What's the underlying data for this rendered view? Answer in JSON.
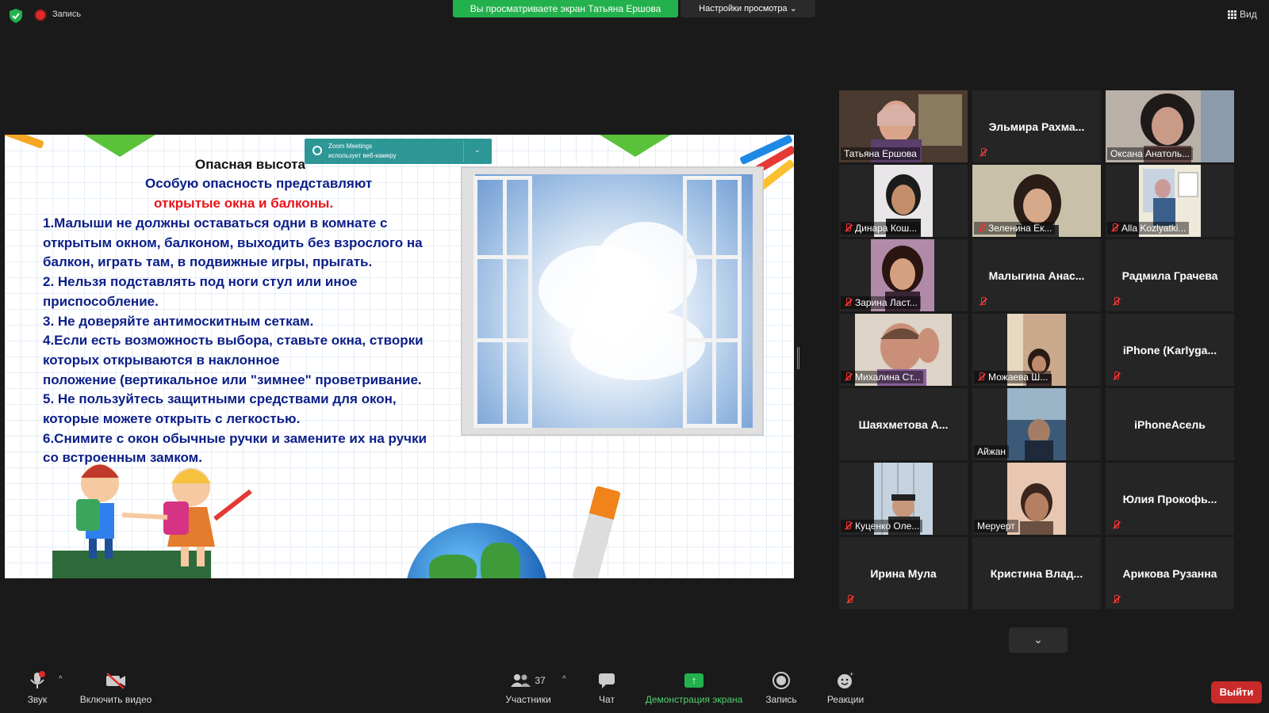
{
  "topbar": {
    "recording_label": "Запись",
    "viewing_banner": "Вы просматриваете экран Татьяна Ершова",
    "view_settings": "Настройки просмотра ⌄",
    "view_label": "Вид"
  },
  "zoom_notice": {
    "line1": "Zoom Meetings",
    "line2": "использует веб-камеру"
  },
  "slide": {
    "title": "Опасная высота",
    "subtitle": "Особую опасность представляют",
    "highlight": "открытые окна и балконы.",
    "lines": [
      "1.Малыши не должны оставаться одни в комнате с",
      "открытым окном, балконом, выходить без взрослого на",
      "балкон, играть там, в подвижные игры, прыгать.",
      "2. Нельзя подставлять под ноги стул или иное",
      "приспособление.",
      "3. Не доверяйте антимоскитным сеткам.",
      "4.Если есть возможность выбора, ставьте окна, створки",
      "которых открываются в наклонное",
      "положение (вертикальное или \"зимнее\" проветривание.",
      "5. Не пользуйтесь защитными средствами для окон,",
      "которые можете открыть с легкостью.",
      "6.Снимите с окон обычные ручки и замените их на ручки",
      "со встроенным замком."
    ]
  },
  "participants": [
    {
      "name": "Татьяна Ершова",
      "video": true,
      "active": true,
      "muted": false
    },
    {
      "name": "Эльмира  Рахма...",
      "video": false,
      "muted": true
    },
    {
      "name": "Оксана Анатоль...",
      "video": true,
      "muted": false
    },
    {
      "name": "Динара Кош...",
      "video": true,
      "muted": true
    },
    {
      "name": "Зеленина Ек...",
      "video": true,
      "muted": true
    },
    {
      "name": "Alla Kozlyatki...",
      "video": true,
      "muted": true
    },
    {
      "name": "Зарина Ласт...",
      "video": true,
      "muted": true
    },
    {
      "name": "Малыгина  Анас...",
      "video": false,
      "muted": true
    },
    {
      "name": "Радмила Грачева",
      "video": false,
      "muted": true
    },
    {
      "name": "Михалина Ст...",
      "video": true,
      "muted": true
    },
    {
      "name": "Можаева Ш...",
      "video": true,
      "muted": true
    },
    {
      "name": "iPhone  (Karlyga...",
      "video": false,
      "muted": true
    },
    {
      "name": "Шаяхметова  А...",
      "video": false,
      "muted": false
    },
    {
      "name": "Айжан",
      "video": true,
      "muted": false
    },
    {
      "name": "iPhoneАсель",
      "video": false,
      "muted": false
    },
    {
      "name": "Куценко Оле...",
      "video": true,
      "muted": true
    },
    {
      "name": "Меруерт",
      "video": true,
      "muted": false
    },
    {
      "name": "Юлия  Прокофь...",
      "video": false,
      "muted": true
    },
    {
      "name": "Ирина Мула",
      "video": false,
      "muted": true
    },
    {
      "name": "Кристина  Влад...",
      "video": false,
      "muted": false
    },
    {
      "name": "Арикова Рузанна",
      "video": false,
      "muted": true
    }
  ],
  "toolbar": {
    "audio": "Звук",
    "video": "Включить видео",
    "participants": "Участники",
    "participants_count": "37",
    "chat": "Чат",
    "share": "Демонстрация экрана",
    "record": "Запись",
    "reactions": "Реакции",
    "exit": "Выйти"
  },
  "colors": {
    "share_green": "#23b14d",
    "exit_red": "#c92a2a",
    "active_speaker": "#e6e65a",
    "slide_blue": "#0b1e88",
    "slide_red": "#e8141a"
  }
}
